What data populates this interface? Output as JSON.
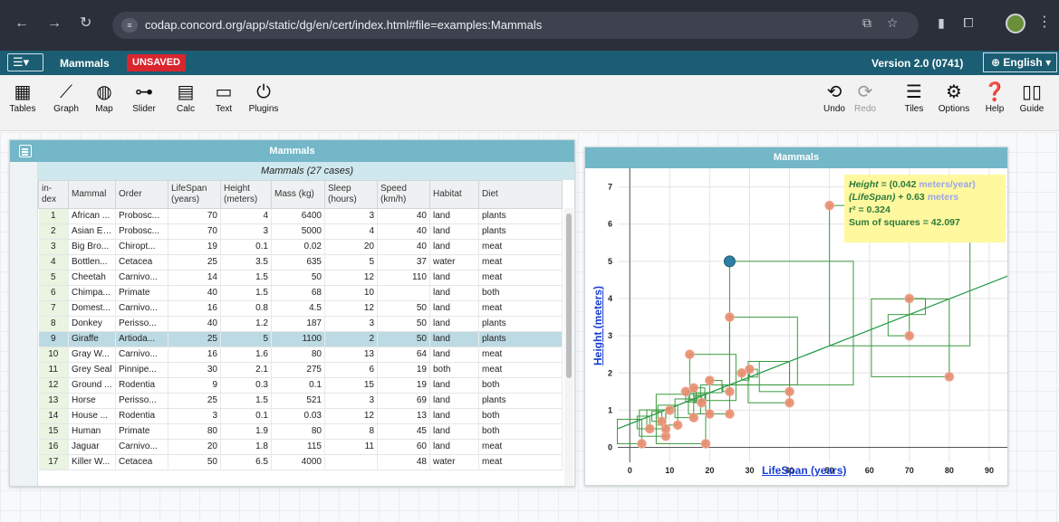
{
  "browser": {
    "url": "codap.concord.org/app/static/dg/en/cert/index.html#file=examples:Mammals",
    "nav_icons": [
      "back-arrow-icon",
      "forward-arrow-icon",
      "reload-icon"
    ]
  },
  "topbar": {
    "doc_title": "Mammals",
    "unsaved_label": "UNSAVED",
    "version": "Version 2.0 (0741)",
    "language": "English"
  },
  "toolbar": {
    "left_tools": [
      {
        "label": "Tables",
        "icon": "table-icon"
      },
      {
        "label": "Graph",
        "icon": "graph-icon"
      },
      {
        "label": "Map",
        "icon": "globe-icon"
      },
      {
        "label": "Slider",
        "icon": "slider-icon"
      },
      {
        "label": "Calc",
        "icon": "calculator-icon"
      },
      {
        "label": "Text",
        "icon": "text-bubble-icon"
      },
      {
        "label": "Plugins",
        "icon": "plug-icon"
      }
    ],
    "right_tools": [
      {
        "label": "Undo",
        "icon": "undo-icon"
      },
      {
        "label": "Redo",
        "icon": "redo-icon"
      },
      {
        "label": "Tiles",
        "icon": "tiles-list-icon"
      },
      {
        "label": "Options",
        "icon": "gear-icon"
      },
      {
        "label": "Help",
        "icon": "help-icon"
      },
      {
        "label": "Guide",
        "icon": "book-icon"
      }
    ]
  },
  "table": {
    "title": "Mammals",
    "cases_title": "Mammals (27 cases)",
    "columns": [
      "in-dex",
      "Mammal",
      "Order",
      "LifeSpan (years)",
      "Height (meters)",
      "Mass (kg)",
      "Sleep (hours)",
      "Speed (km/h)",
      "Habitat",
      "Diet"
    ],
    "selected_index": 9,
    "rows": [
      [
        "1",
        "African ...",
        "Probosc...",
        "70",
        "4",
        "6400",
        "3",
        "40",
        "land",
        "plants"
      ],
      [
        "2",
        "Asian El...",
        "Probosc...",
        "70",
        "3",
        "5000",
        "4",
        "40",
        "land",
        "plants"
      ],
      [
        "3",
        "Big Bro...",
        "Chiropt...",
        "19",
        "0.1",
        "0.02",
        "20",
        "40",
        "land",
        "meat"
      ],
      [
        "4",
        "Bottlen...",
        "Cetacea",
        "25",
        "3.5",
        "635",
        "5",
        "37",
        "water",
        "meat"
      ],
      [
        "5",
        "Cheetah",
        "Carnivo...",
        "14",
        "1.5",
        "50",
        "12",
        "110",
        "land",
        "meat"
      ],
      [
        "6",
        "Chimpa...",
        "Primate",
        "40",
        "1.5",
        "68",
        "10",
        "",
        "land",
        "both"
      ],
      [
        "7",
        "Domest...",
        "Carnivo...",
        "16",
        "0.8",
        "4.5",
        "12",
        "50",
        "land",
        "meat"
      ],
      [
        "8",
        "Donkey",
        "Perisso...",
        "40",
        "1.2",
        "187",
        "3",
        "50",
        "land",
        "plants"
      ],
      [
        "9",
        "Giraffe",
        "Artioda...",
        "25",
        "5",
        "1100",
        "2",
        "50",
        "land",
        "plants"
      ],
      [
        "10",
        "Gray W...",
        "Carnivo...",
        "16",
        "1.6",
        "80",
        "13",
        "64",
        "land",
        "meat"
      ],
      [
        "11",
        "Grey Seal",
        "Pinnipe...",
        "30",
        "2.1",
        "275",
        "6",
        "19",
        "both",
        "meat"
      ],
      [
        "12",
        "Ground ...",
        "Rodentia",
        "9",
        "0.3",
        "0.1",
        "15",
        "19",
        "land",
        "both"
      ],
      [
        "13",
        "Horse",
        "Perisso...",
        "25",
        "1.5",
        "521",
        "3",
        "69",
        "land",
        "plants"
      ],
      [
        "14",
        "House ...",
        "Rodentia",
        "3",
        "0.1",
        "0.03",
        "12",
        "13",
        "land",
        "both"
      ],
      [
        "15",
        "Human",
        "Primate",
        "80",
        "1.9",
        "80",
        "8",
        "45",
        "land",
        "both"
      ],
      [
        "16",
        "Jaguar",
        "Carnivo...",
        "20",
        "1.8",
        "115",
        "11",
        "60",
        "land",
        "meat"
      ],
      [
        "17",
        "Killer W...",
        "Cetacea",
        "50",
        "6.5",
        "4000",
        "",
        "48",
        "water",
        "meat"
      ]
    ]
  },
  "graph": {
    "title": "Mammals",
    "x_label": "LifeSpan (years)",
    "y_label": "Height (meters)",
    "x_ticks": [
      "0",
      "10",
      "20",
      "30",
      "40",
      "50",
      "60",
      "70",
      "80",
      "90"
    ],
    "y_ticks": [
      "0",
      "1",
      "2",
      "3",
      "4",
      "5",
      "6",
      "7"
    ],
    "x_range": [
      -3,
      95
    ],
    "y_range": [
      -0.4,
      7.5
    ],
    "regression": {
      "slope": 0.042,
      "intercept": 0.63,
      "line1_var": "Height",
      "line1_eq": "= (0.042",
      "line1_unit": "meters/year)",
      "line2_var": "(LifeSpan)",
      "line2_eq": "+ 0.63",
      "line2_unit": "meters",
      "r2": "r² = 0.324",
      "sum_squares": "Sum of squares = 42.097"
    },
    "highlighted_point": {
      "x": 25,
      "y": 5
    },
    "points": [
      {
        "x": 70,
        "y": 4
      },
      {
        "x": 70,
        "y": 3
      },
      {
        "x": 19,
        "y": 0.1
      },
      {
        "x": 25,
        "y": 3.5
      },
      {
        "x": 14,
        "y": 1.5
      },
      {
        "x": 40,
        "y": 1.5
      },
      {
        "x": 16,
        "y": 0.8
      },
      {
        "x": 40,
        "y": 1.2
      },
      {
        "x": 16,
        "y": 1.6
      },
      {
        "x": 30,
        "y": 2.1
      },
      {
        "x": 9,
        "y": 0.3
      },
      {
        "x": 25,
        "y": 1.5
      },
      {
        "x": 3,
        "y": 0.1
      },
      {
        "x": 80,
        "y": 1.9
      },
      {
        "x": 20,
        "y": 1.8
      },
      {
        "x": 50,
        "y": 6.5
      },
      {
        "x": 15,
        "y": 2.5
      },
      {
        "x": 5,
        "y": 0.5
      },
      {
        "x": 8,
        "y": 0.7
      },
      {
        "x": 10,
        "y": 1.0
      },
      {
        "x": 12,
        "y": 0.6
      },
      {
        "x": 18,
        "y": 1.2
      },
      {
        "x": 20,
        "y": 0.9
      },
      {
        "x": 9,
        "y": 0.5
      },
      {
        "x": 25,
        "y": 0.9
      },
      {
        "x": 28,
        "y": 2.0
      }
    ],
    "colors": {
      "point": "#e98b6d",
      "highlight": "#2c7fa0",
      "line": "#1a9640",
      "square": "#3a9a3e"
    }
  }
}
